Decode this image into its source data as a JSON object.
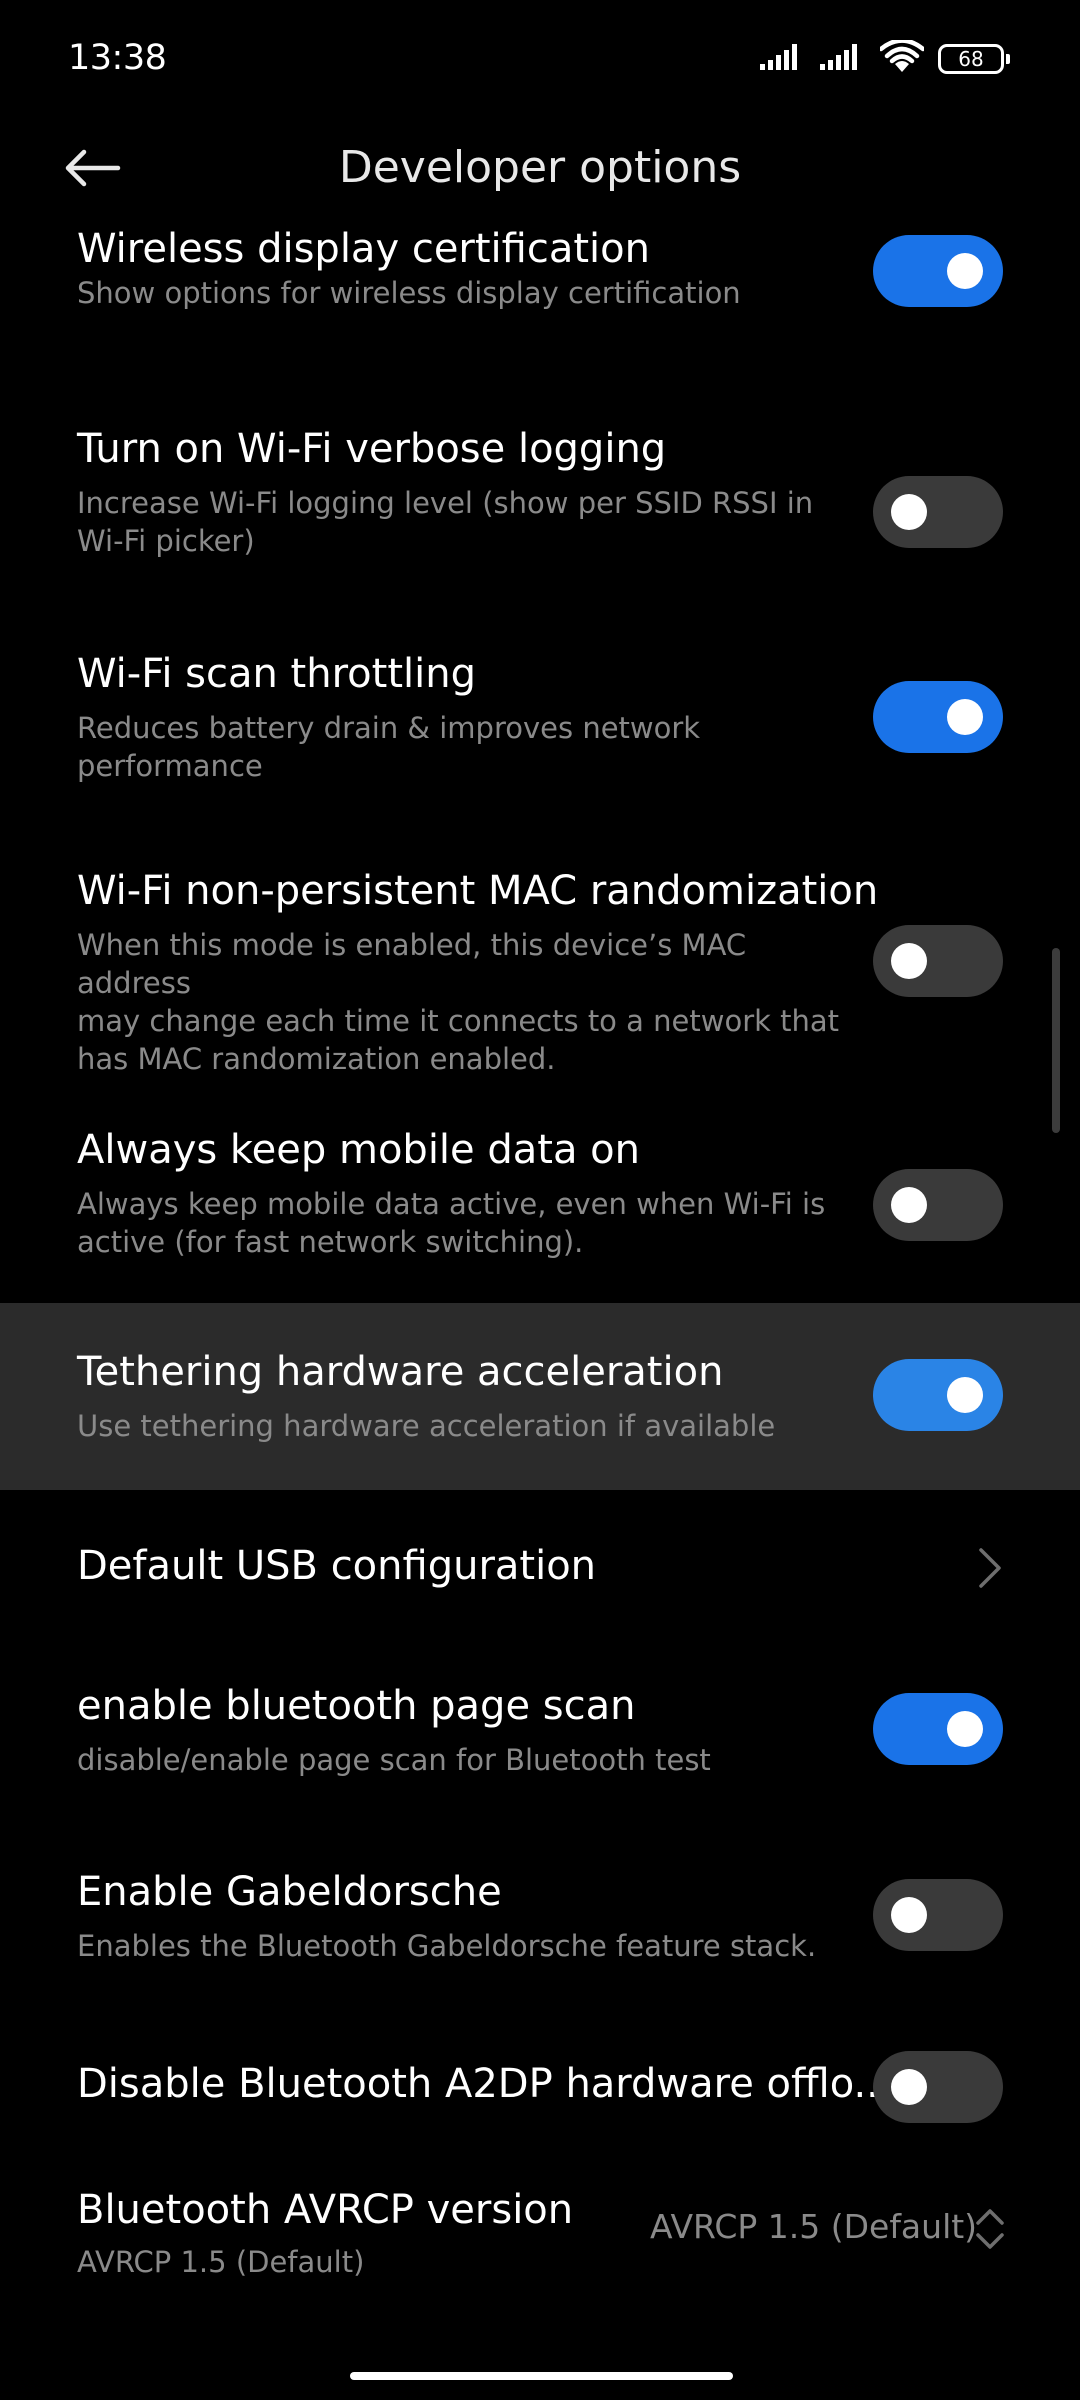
{
  "status_bar": {
    "time": "13:38",
    "battery": "68",
    "icons": [
      "signal-icon",
      "signal-icon",
      "wifi-icon",
      "battery-icon"
    ]
  },
  "header": {
    "title": "Developer options",
    "back_icon": "back-arrow-icon"
  },
  "settings": [
    {
      "title": "Wireless display certification",
      "subtitle": "Show options for wireless display certification",
      "control": "toggle",
      "on": true
    },
    {
      "title": "Turn on Wi-Fi verbose logging",
      "subtitle_lines": [
        "Increase Wi-Fi logging level (show per SSID RSSI in",
        "Wi-Fi picker)"
      ],
      "control": "toggle",
      "on": false
    },
    {
      "title": "Wi-Fi scan throttling",
      "subtitle_lines": [
        "Reduces battery drain & improves network",
        "performance"
      ],
      "control": "toggle",
      "on": true
    },
    {
      "title": "Wi-Fi non-persistent MAC randomization",
      "subtitle_lines": [
        "When this mode is enabled, this device’s MAC address",
        "may change each time it connects to a network that",
        "has MAC randomization enabled."
      ],
      "control": "toggle",
      "on": false
    },
    {
      "title": "Always keep mobile data on",
      "subtitle_lines": [
        "Always keep mobile data active, even when Wi-Fi is",
        "active (for fast network switching)."
      ],
      "control": "toggle",
      "on": false
    },
    {
      "title": "Tethering hardware acceleration",
      "subtitle": "Use tethering hardware acceleration if available",
      "control": "toggle",
      "on": true,
      "highlighted": true
    },
    {
      "title": "Default USB configuration",
      "control": "chevron"
    },
    {
      "title": "enable bluetooth page scan",
      "subtitle": "disable/enable page scan for Bluetooth test",
      "control": "toggle",
      "on": true
    },
    {
      "title": "Enable Gabeldorsche",
      "subtitle": "Enables the Bluetooth Gabeldorsche feature stack.",
      "control": "toggle",
      "on": false
    },
    {
      "title": "Disable Bluetooth A2DP hardware offlo...",
      "control": "toggle",
      "on": false
    },
    {
      "title": "Bluetooth AVRCP version",
      "subtitle": "AVRCP 1.5 (Default)",
      "control": "select",
      "value": "AVRCP 1.5 (Default)"
    }
  ],
  "colors": {
    "background": "#000000",
    "toggle_on": "#1a73e8",
    "toggle_off": "#3a3a3a",
    "highlight_row": "#2b2b2b",
    "subtitle": "#8a8a8a"
  }
}
